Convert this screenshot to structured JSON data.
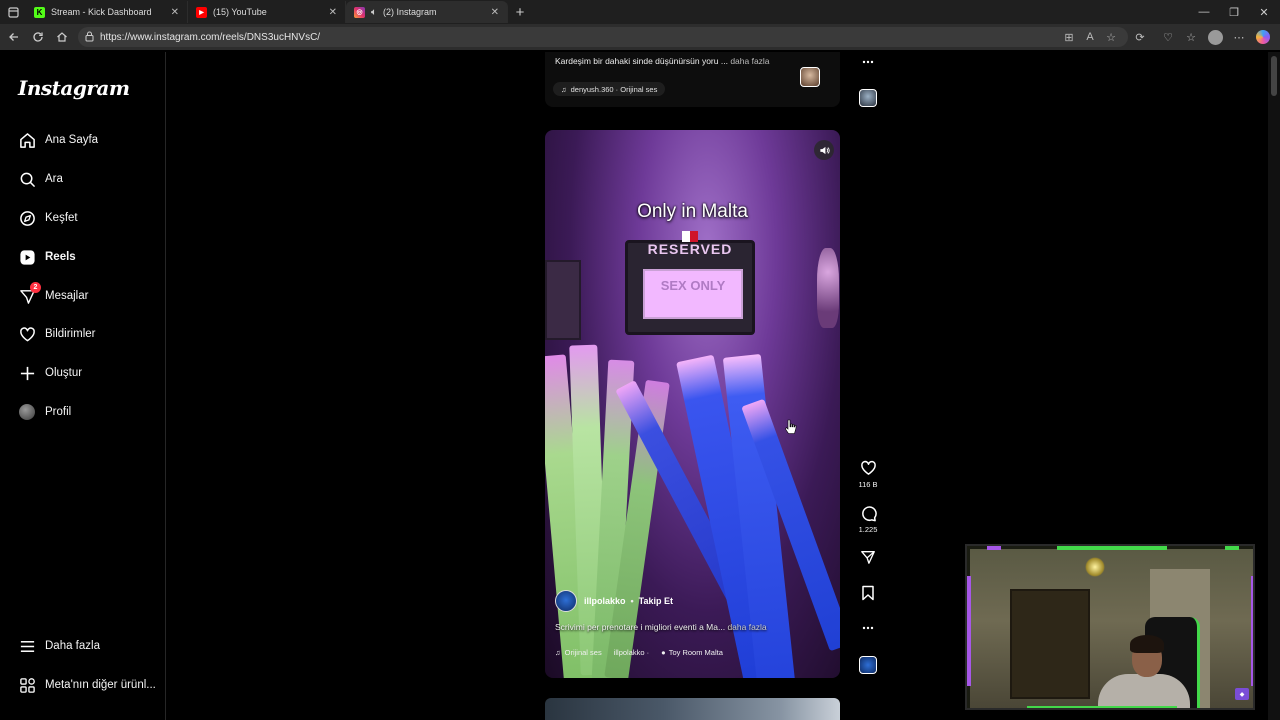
{
  "browser": {
    "tabs": [
      {
        "title": "Stream - Kick Dashboard",
        "icon": "kick-icon"
      },
      {
        "title": "(15) YouTube",
        "icon": "youtube-icon"
      },
      {
        "title": "(2) Instagram",
        "icon": "instagram-icon"
      }
    ],
    "url": "https://www.instagram.com/reels/DNS3ucHNVsC/"
  },
  "sidebar": {
    "logo": "Instagram",
    "items": [
      {
        "label": "Ana Sayfa",
        "icon": "home-icon"
      },
      {
        "label": "Ara",
        "icon": "search-icon"
      },
      {
        "label": "Keşfet",
        "icon": "compass-icon"
      },
      {
        "label": "Reels",
        "icon": "reels-icon"
      },
      {
        "label": "Mesajlar",
        "icon": "messages-icon",
        "badge": "2"
      },
      {
        "label": "Bildirimler",
        "icon": "heart-icon"
      },
      {
        "label": "Oluştur",
        "icon": "plus-icon"
      },
      {
        "label": "Profil",
        "icon": "avatar"
      }
    ],
    "more": "Daha fazla",
    "meta": "Meta'nın diğer ürünl..."
  },
  "previous_reel": {
    "caption": "Kardeşim bir dahaki sinde düşünürsün yoru ...",
    "more": "daha fazla",
    "audio": "denyush.360 · Orijinal ses"
  },
  "reel": {
    "title": "Only in Malta",
    "sign_top": "RESERVED",
    "sign_text": "SEX ONLY",
    "username": "illpolakko",
    "follow": "Takip Et",
    "caption": "Scrivimi per prenotare i migliori eventi a Ma...",
    "more": "daha fazla",
    "audio": "Orijinal ses",
    "audio_user": "illpolakko ·",
    "location": "Toy Room Malta",
    "likes": "116 B",
    "comments": "1.225"
  },
  "colors": {
    "accent_badge": "#ff3040",
    "kick_green": "#53fc18",
    "youtube_red": "#ff0000",
    "instagram_pink": "#e1306c"
  }
}
